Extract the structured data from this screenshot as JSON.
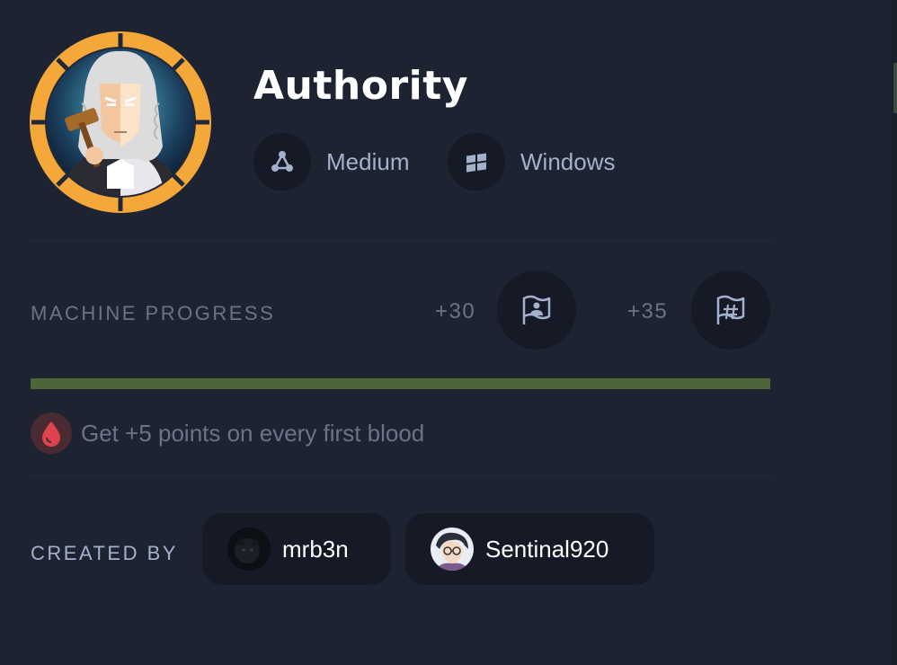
{
  "machine": {
    "name": "Authority",
    "difficulty": "Medium",
    "os": "Windows"
  },
  "progress": {
    "label": "MACHINE PROGRESS",
    "user_points": "+30",
    "root_points": "+35",
    "percent": 100,
    "fill_color": "#4e6439"
  },
  "first_blood": {
    "text": "Get +5 points on every first blood"
  },
  "creators": {
    "label": "CREATED BY",
    "list": [
      {
        "name": "mrb3n"
      },
      {
        "name": "Sentinal920"
      }
    ]
  },
  "icons": {
    "difficulty": "difficulty-nodes-icon",
    "os": "windows-logo-icon",
    "user_flag": "user-flag-icon",
    "root_flag": "root-flag-icon",
    "blood": "blood-drop-icon"
  },
  "colors": {
    "background": "#1e2332",
    "avatar_ring": "#f4a83a",
    "blood_accent": "#e0434d"
  }
}
